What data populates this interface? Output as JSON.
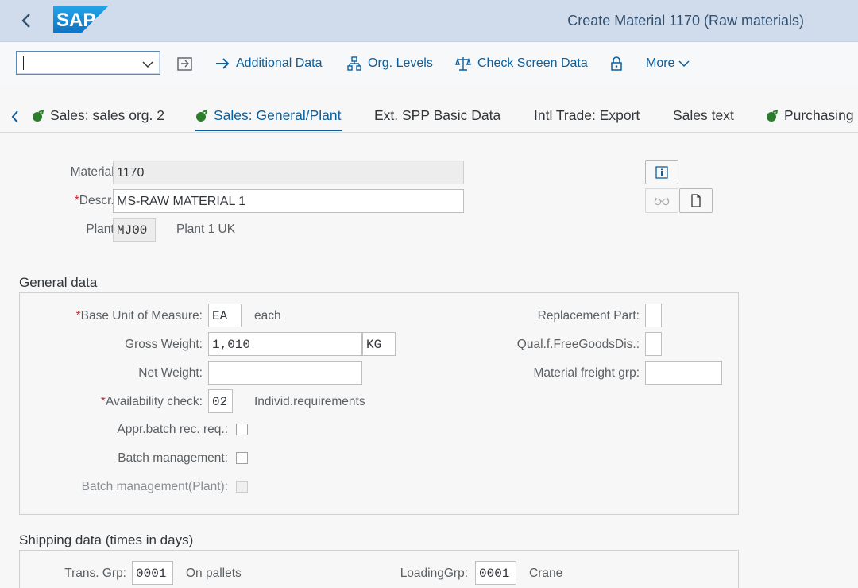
{
  "shell": {
    "title": "Create Material 1170 (Raw materials)",
    "logo_text": "SAP"
  },
  "toolbar": {
    "command_value": "",
    "additional_data": "Additional Data",
    "org_levels": "Org. Levels",
    "check_screen_data": "Check Screen Data",
    "more": "More"
  },
  "tabs": [
    {
      "label": "Sales: sales org. 2",
      "has_icon": true,
      "active": false
    },
    {
      "label": "Sales: General/Plant",
      "has_icon": true,
      "active": true
    },
    {
      "label": "Ext. SPP Basic Data",
      "has_icon": false,
      "active": false
    },
    {
      "label": "Intl Trade: Export",
      "has_icon": false,
      "active": false
    },
    {
      "label": "Sales text",
      "has_icon": false,
      "active": false
    },
    {
      "label": "Purchasing",
      "has_icon": true,
      "active": false
    }
  ],
  "header": {
    "material_label": "Material:",
    "material_value": "1170",
    "descr_label": "Descr.:",
    "descr_value": "MS-RAW MATERIAL 1",
    "plant_label": "Plant:",
    "plant_value": "MJ00",
    "plant_text": "Plant 1 UK"
  },
  "general": {
    "title": "General data",
    "base_uom_label": "Base Unit of Measure:",
    "base_uom_value": "EA",
    "base_uom_text": "each",
    "gross_weight_label": "Gross Weight:",
    "gross_weight_value": "1,010",
    "weight_unit_value": "KG",
    "net_weight_label": "Net Weight:",
    "net_weight_value": "",
    "availability_label": "Availability check:",
    "availability_value": "02",
    "availability_text": "Individ.requirements",
    "appr_batch_label": "Appr.batch rec. req.:",
    "batch_mgmt_label": "Batch management:",
    "batch_mgmt_plant_label": "Batch management(Plant):",
    "replacement_label": "Replacement Part:",
    "qual_free_label": "Qual.f.FreeGoodsDis.:",
    "freight_grp_label": "Material freight grp:"
  },
  "shipping": {
    "title": "Shipping data (times in days)",
    "trans_grp_label": "Trans. Grp:",
    "trans_grp_value": "0001",
    "trans_grp_text": "On pallets",
    "loading_grp_label": "LoadingGrp:",
    "loading_grp_value": "0001",
    "loading_grp_text": "Crane"
  },
  "colors": {
    "shell_bg": "#d0dceb",
    "accent": "#0a5f9e",
    "required": "#d0252e",
    "sap_logo": "#1b8ad3"
  }
}
